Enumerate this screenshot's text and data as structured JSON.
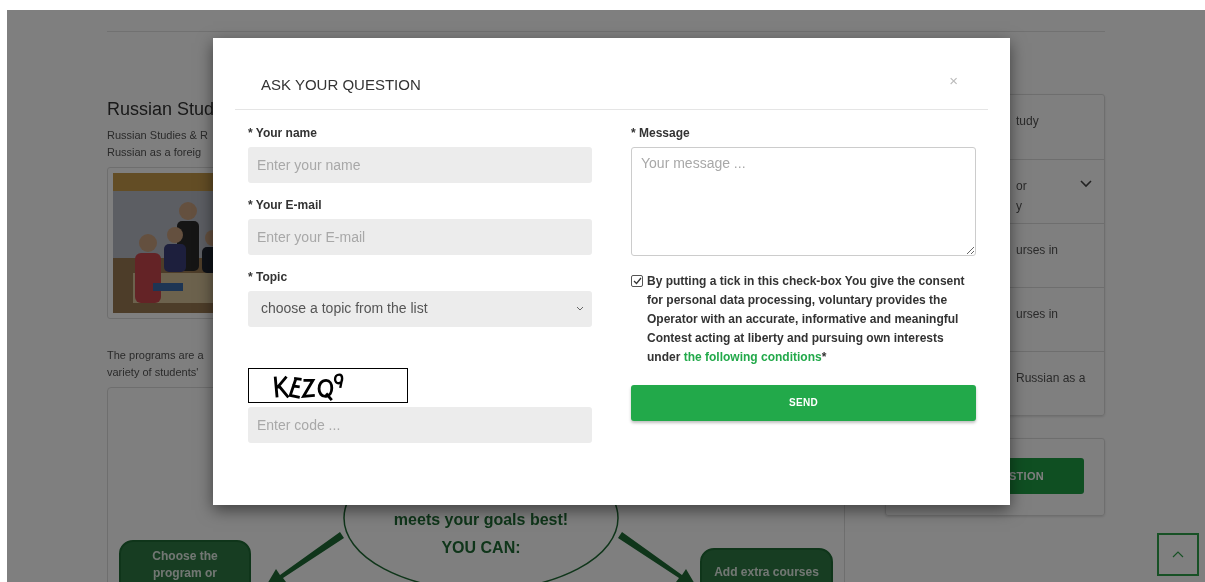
{
  "page": {
    "title": "Russian Stud",
    "intro_lines": [
      "Russian Studies & R",
      "Russian as a foreig"
    ],
    "body_lines": [
      "The programs are a",
      "variety of students'"
    ],
    "diagram": {
      "headline": "meets your goals best!",
      "subhead": "YOU CAN:",
      "left_box": [
        "Choose the",
        "program or"
      ],
      "right_box": [
        "Add extra courses"
      ]
    }
  },
  "sidebar": {
    "items": [
      {
        "lines": [
          "tudy"
        ],
        "has_dropdown": false
      },
      {
        "lines": [
          "or",
          "y"
        ],
        "has_dropdown": true
      },
      {
        "lines": [
          "urses in"
        ],
        "has_dropdown": false
      },
      {
        "lines": [
          "urses in"
        ],
        "has_dropdown": false
      },
      {
        "lines": [
          "Russian as a"
        ],
        "has_dropdown": false
      }
    ],
    "button": "STION"
  },
  "modal": {
    "title": "ASK YOUR QUESTION",
    "close": "×",
    "fields": [
      {
        "kind": "input",
        "label": "* Your name",
        "placeholder": "Enter your name"
      },
      {
        "kind": "input",
        "label": "* Your E-mail",
        "placeholder": "Enter your E-mail"
      },
      {
        "kind": "select",
        "label": "* Topic",
        "value": "choose a topic from the list"
      }
    ],
    "captcha": {
      "placeholder": "Enter code ..."
    },
    "message": {
      "label": "* Message",
      "placeholder": "Your message ..."
    },
    "consent": {
      "checked": true,
      "text": "By putting a tick in this check-box You give the consent for personal data processing, voluntary provides the Operator with an accurate, informative and meaningful Contest acting at liberty and pursuing own interests under ",
      "link": "the following conditions",
      "suffix": "*"
    },
    "send": "SEND"
  }
}
